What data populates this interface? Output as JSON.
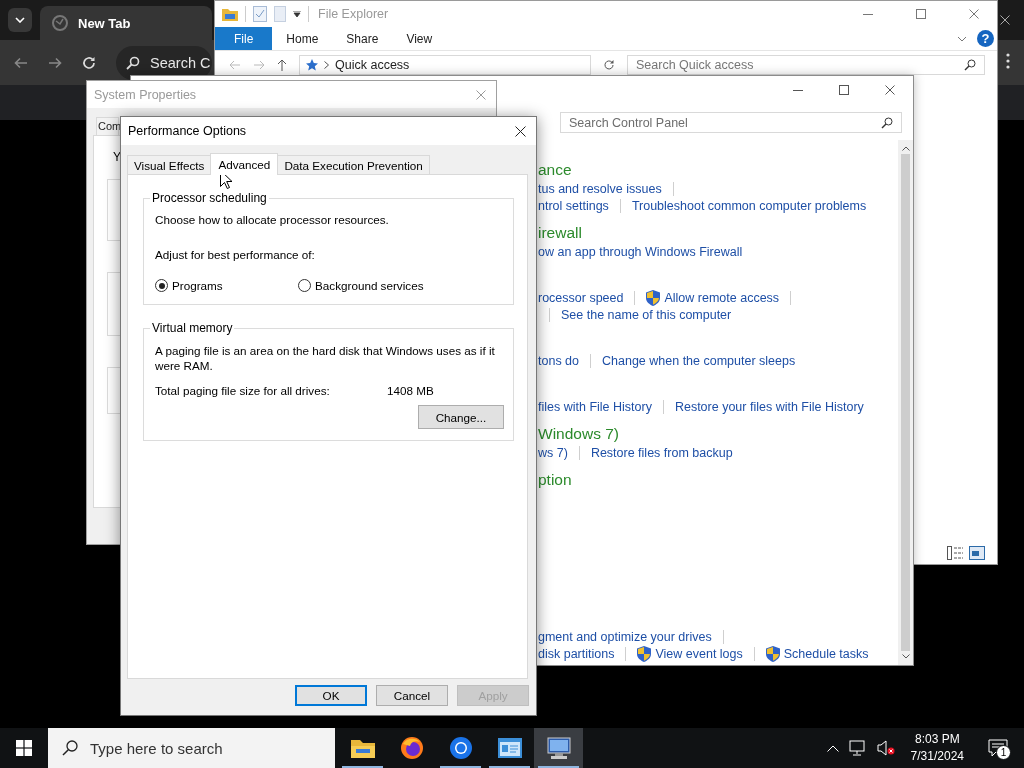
{
  "browser": {
    "tab_title": "New Tab",
    "omnibox_text": "Search C"
  },
  "file_explorer": {
    "title": "File Explorer",
    "ribbon_tabs": [
      {
        "label": "File",
        "selected": true
      },
      {
        "label": "Home",
        "selected": false
      },
      {
        "label": "Share",
        "selected": false
      },
      {
        "label": "View",
        "selected": false
      }
    ],
    "help_glyph": "?",
    "address": "Quick access",
    "search": {
      "placeholder": "Search Quick access"
    }
  },
  "control_panel": {
    "search": {
      "placeholder": "Search Control Panel"
    },
    "groups": [
      {
        "heading": "ance",
        "rows": [
          {
            "leading_separator": false,
            "trailing_separator": true,
            "links": [
              {
                "text": "tus and resolve issues",
                "shield": false
              }
            ]
          },
          {
            "leading_separator": false,
            "trailing_separator": false,
            "links": [
              {
                "text": "ntrol settings",
                "shield": false
              },
              {
                "text": "Troubleshoot common computer problems",
                "shield": false
              }
            ]
          }
        ]
      },
      {
        "heading": "irewall",
        "rows": [
          {
            "leading_separator": false,
            "trailing_separator": false,
            "links": [
              {
                "text": "ow an app through Windows Firewall",
                "shield": false
              }
            ]
          }
        ]
      },
      {
        "rows": [
          {
            "leading_separator": false,
            "trailing_separator": true,
            "links": [
              {
                "text": "rocessor speed",
                "shield": false
              },
              {
                "text": "Allow remote access",
                "shield": true
              }
            ]
          },
          {
            "leading_separator": true,
            "trailing_separator": false,
            "links": [
              {
                "text": "See the name of this computer",
                "shield": false
              }
            ]
          }
        ]
      },
      {
        "rows": [
          {
            "leading_separator": false,
            "trailing_separator": false,
            "links": [
              {
                "text": "tons do",
                "shield": false
              },
              {
                "text": "Change when the computer sleeps",
                "shield": false
              }
            ]
          }
        ]
      },
      {
        "rows": [
          {
            "leading_separator": false,
            "trailing_separator": false,
            "links": [
              {
                "text": "files with File History",
                "shield": false
              },
              {
                "text": "Restore your files with File History",
                "shield": false
              }
            ]
          }
        ]
      },
      {
        "heading": "Windows 7)",
        "rows": [
          {
            "leading_separator": false,
            "trailing_separator": false,
            "links": [
              {
                "text": "ws 7)",
                "shield": false
              },
              {
                "text": "Restore files from backup",
                "shield": false
              }
            ]
          }
        ]
      },
      {
        "heading": "ption"
      },
      {
        "rows": [
          {
            "leading_separator": false,
            "trailing_separator": true,
            "links": [
              {
                "text": "gment and optimize your drives",
                "shield": false
              }
            ]
          },
          {
            "leading_separator": false,
            "trailing_separator": false,
            "links": [
              {
                "text": "disk partitions",
                "shield": false
              },
              {
                "text": "View event logs",
                "shield": true
              },
              {
                "text": "Schedule tasks",
                "shield": true
              }
            ]
          }
        ]
      }
    ]
  },
  "system_properties": {
    "title": "System Properties",
    "tab_label": "Com",
    "text_fragment": "Y"
  },
  "performance_options": {
    "title": "Performance Options",
    "tabs": [
      {
        "label": "Visual Effects",
        "selected": false
      },
      {
        "label": "Advanced",
        "selected": true
      },
      {
        "label": "Data Execution Prevention",
        "selected": false
      }
    ],
    "processor_scheduling": {
      "title": "Processor scheduling",
      "description": "Choose how to allocate processor resources.",
      "prompt": "Adjust for best performance of:",
      "options": [
        {
          "label": "Programs",
          "selected": true
        },
        {
          "label": "Background services",
          "selected": false
        }
      ]
    },
    "virtual_memory": {
      "title": "Virtual memory",
      "description": "A paging file is an area on the hard disk that Windows uses as if it were RAM.",
      "total_label": "Total paging file size for all drives:",
      "total_value": "1408 MB",
      "change_button": "Change..."
    },
    "buttons": [
      {
        "label": "OK",
        "default": true,
        "disabled": false
      },
      {
        "label": "Cancel",
        "default": false,
        "disabled": false
      },
      {
        "label": "Apply",
        "default": false,
        "disabled": true
      }
    ]
  },
  "taskbar": {
    "search": {
      "placeholder": "Type here to search"
    },
    "apps": [
      {
        "kind": "folder",
        "running": true,
        "selected": false
      },
      {
        "kind": "fox",
        "running": false,
        "selected": false
      },
      {
        "kind": "ring",
        "running": true,
        "selected": false
      },
      {
        "kind": "window",
        "running": true,
        "selected": false
      },
      {
        "kind": "computer",
        "running": true,
        "selected": true
      }
    ],
    "time": "8:03 PM",
    "date": "7/31/2024",
    "notification_count": "1"
  }
}
